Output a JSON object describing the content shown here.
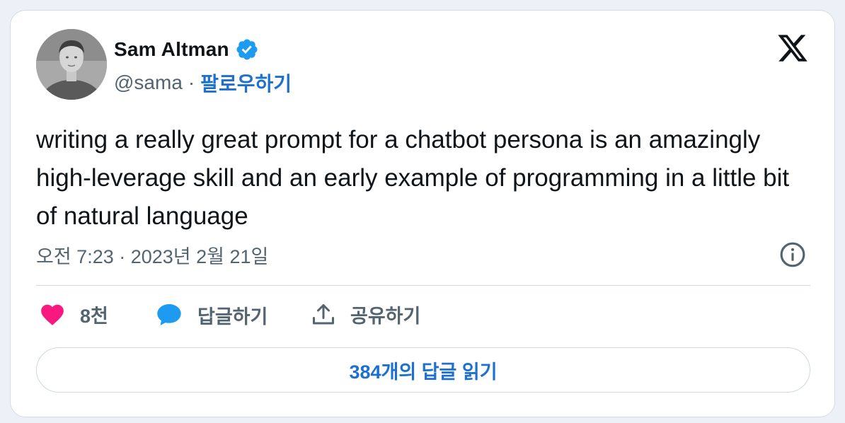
{
  "author": {
    "name": "Sam Altman",
    "handle": "@sama",
    "separator": "·",
    "follow_label": "팔로우하기"
  },
  "tweet": {
    "text": "writing a really great prompt for a chatbot persona is an amazingly high-leverage skill and an early example of programming in a little bit of natural language",
    "timestamp": "오전 7:23 · 2023년 2월 21일"
  },
  "actions": {
    "like_count": "8천",
    "reply_label": "답글하기",
    "share_label": "공유하기"
  },
  "read_replies_label": "384개의 답글 읽기",
  "icons": {
    "verified": "verified-badge-icon",
    "x_logo": "x-logo-icon",
    "info": "info-icon",
    "heart": "heart-icon",
    "reply": "speech-bubble-icon",
    "share": "share-upload-icon"
  },
  "colors": {
    "accent": "#1d6fd0",
    "verified": "#1d9bf0",
    "like": "#f91880",
    "reply_icon": "#1d9bf0",
    "text": "#0f1419",
    "muted": "#536471"
  }
}
